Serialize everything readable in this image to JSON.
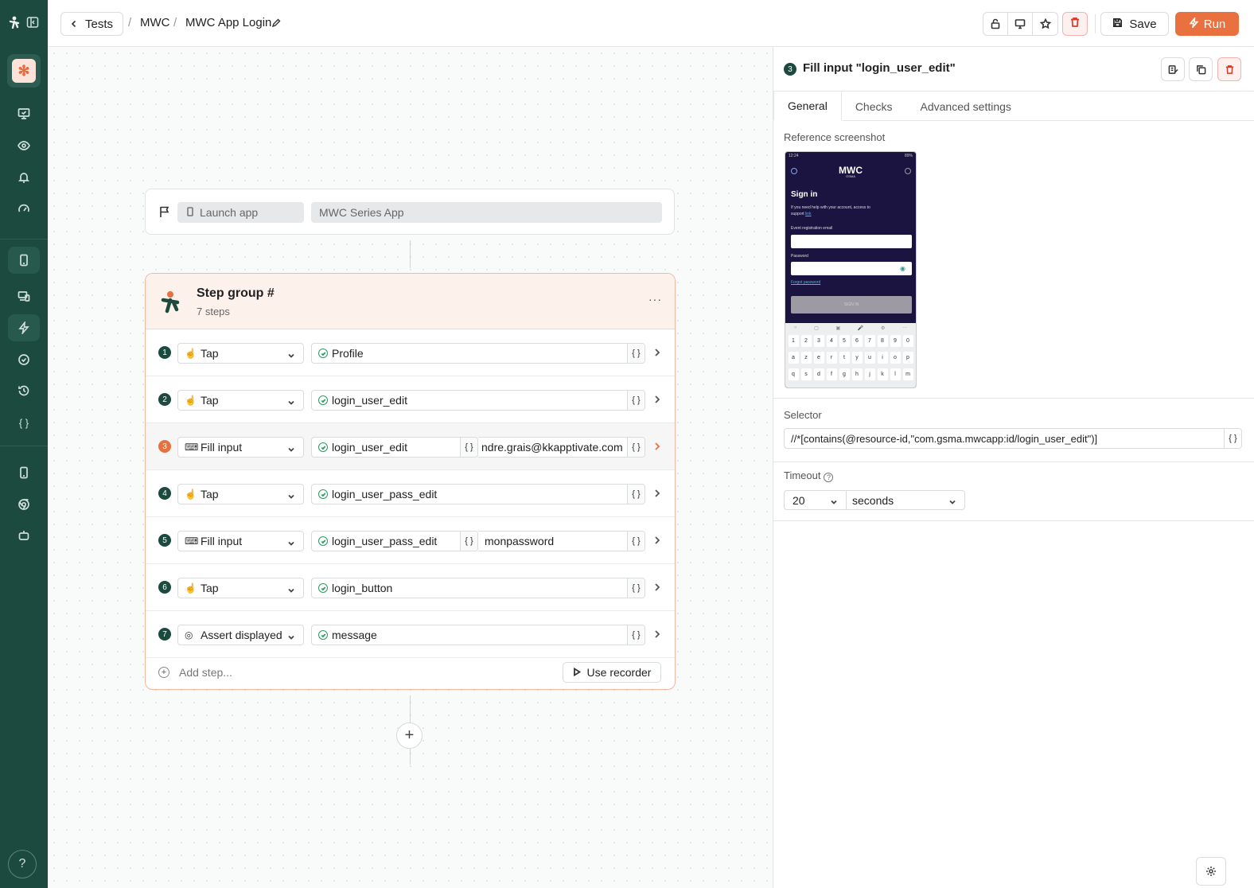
{
  "breadcrumb": {
    "back_label": "Tests",
    "project": "MWC",
    "test_name": "MWC App Login"
  },
  "toolbar": {
    "save_label": "Save",
    "run_label": "Run"
  },
  "launch": {
    "action": "Launch app",
    "app": "MWC Series App"
  },
  "group": {
    "title": "Step group #",
    "subtitle": "7 steps",
    "more": "···",
    "steps": [
      {
        "num": "1",
        "action": "Tap",
        "target": "Profile"
      },
      {
        "num": "2",
        "action": "Tap",
        "target": "login_user_edit"
      },
      {
        "num": "3",
        "action": "Fill input",
        "target": "login_user_edit",
        "value": "ndre.grais@kkapptivate.com"
      },
      {
        "num": "4",
        "action": "Tap",
        "target": "login_user_pass_edit"
      },
      {
        "num": "5",
        "action": "Fill input",
        "target": "login_user_pass_edit",
        "value": "monpassword"
      },
      {
        "num": "6",
        "action": "Tap",
        "target": "login_button"
      },
      {
        "num": "7",
        "action": "Assert displayed",
        "target": "message"
      }
    ],
    "add_step": "Add step...",
    "use_recorder": "Use recorder"
  },
  "braces": "{ }",
  "panel": {
    "num": "3",
    "title": "Fill input \"login_user_edit\"",
    "tabs": [
      "General",
      "Checks",
      "Advanced settings"
    ],
    "reference_label": "Reference screenshot",
    "selector_label": "Selector",
    "selector_value": "//*[contains(@resource-id,\"com.gsma.mwcapp:id/login_user_edit\")]",
    "timeout_label": "Timeout",
    "timeout_value": "20",
    "timeout_unit": "seconds"
  },
  "phone": {
    "status_time": "12:24",
    "status_right": "89%",
    "brand": "MWC",
    "brand_sub": "GSMA",
    "sign_in": "Sign in",
    "help_line1": "If you need help with your account, access to",
    "help_line2": "support",
    "help_link": "link",
    "email_label": "Event registration email",
    "password_label": "Password",
    "forgot": "Forgot password",
    "signin_btn": "SIGN IN",
    "keys_row1": [
      "1",
      "2",
      "3",
      "4",
      "5",
      "6",
      "7",
      "8",
      "9",
      "0"
    ],
    "keys_row2": [
      "a",
      "z",
      "e",
      "r",
      "t",
      "y",
      "u",
      "i",
      "o",
      "p"
    ],
    "keys_row3": [
      "q",
      "s",
      "d",
      "f",
      "g",
      "h",
      "j",
      "k",
      "l",
      "m"
    ]
  },
  "colors": {
    "sidebar": "#1c4a3e",
    "accent": "#e9703f",
    "danger": "#d8392b",
    "ok": "#2e9b63"
  }
}
